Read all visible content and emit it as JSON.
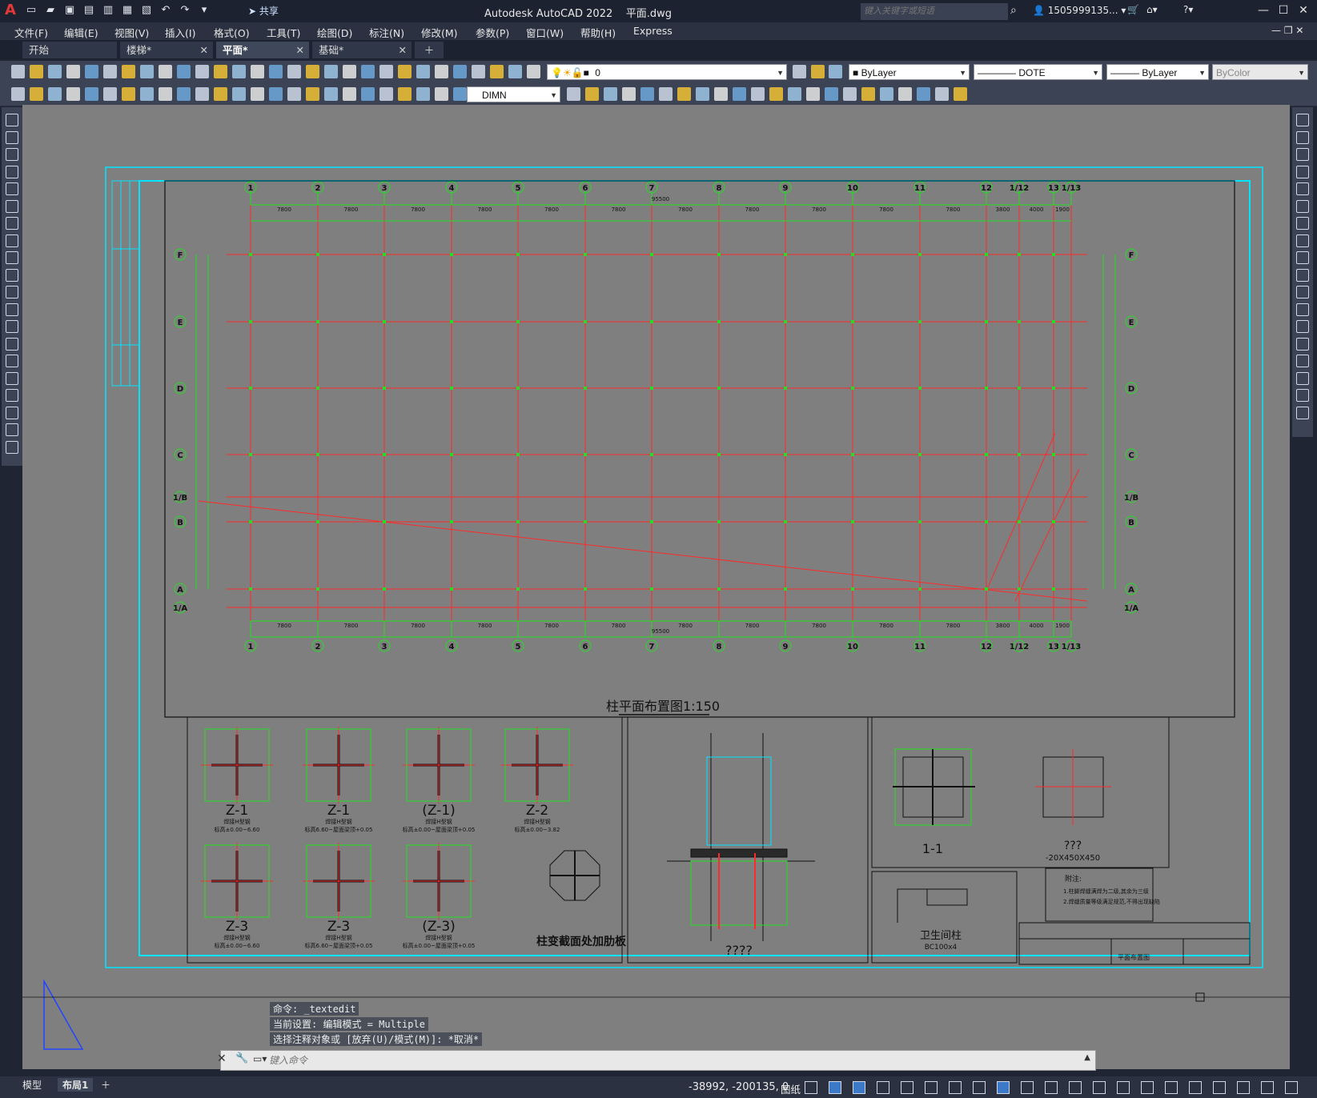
{
  "app": {
    "title": "Autodesk AutoCAD 2022",
    "document": "平面.dwg",
    "share_label": "共享",
    "search_placeholder": "键入关键字或短语",
    "user": "1505999135...",
    "logo": "A"
  },
  "menu": [
    "文件(F)",
    "编辑(E)",
    "视图(V)",
    "插入(I)",
    "格式(O)",
    "工具(T)",
    "绘图(D)",
    "标注(N)",
    "修改(M)",
    "参数(P)",
    "窗口(W)",
    "帮助(H)",
    "Express"
  ],
  "tabs": [
    {
      "label": "开始",
      "active": false,
      "closable": false
    },
    {
      "label": "楼梯*",
      "active": false,
      "closable": true
    },
    {
      "label": "平面*",
      "active": true,
      "closable": true
    },
    {
      "label": "基础*",
      "active": false,
      "closable": true
    }
  ],
  "toolbar": {
    "layer_value": "0",
    "color_value": "ByLayer",
    "linetype_value": "DOTE",
    "lineweight_value": "ByLayer",
    "plotstyle_value": "ByColor",
    "dimstyle_value": "DIMN"
  },
  "drawing": {
    "grid_cols": [
      "1",
      "2",
      "3",
      "4",
      "5",
      "6",
      "7",
      "8",
      "9",
      "10",
      "11",
      "12",
      "1/12",
      "13",
      "1/13"
    ],
    "grid_rows": [
      "F",
      "E",
      "D",
      "C",
      "1/B",
      "B",
      "A",
      "1/A"
    ],
    "span_dims_top": [
      "7800",
      "7800",
      "7800",
      "7800",
      "7800",
      "7800",
      "7800",
      "7800",
      "7800",
      "7800",
      "7800",
      "3800",
      "4000",
      "1900"
    ],
    "total_dim": "95500",
    "plan_title": "柱平面布置图1:150",
    "sections": [
      {
        "name": "Z-1",
        "desc": "焊接H型钢",
        "elev": "标高±0.00~6.60"
      },
      {
        "name": "Z-1",
        "desc": "焊接H型钢",
        "elev": "标高6.60~屋面梁顶+0.05"
      },
      {
        "name": "(Z-1)",
        "desc": "焊接H型钢",
        "elev": "标高±0.00~屋面梁顶+0.05"
      },
      {
        "name": "Z-2",
        "desc": "焊接H型钢",
        "elev": "标高±0.00~3.82"
      },
      {
        "name": "Z-3",
        "desc": "焊接H型钢",
        "elev": "标高±0.00~6.60"
      },
      {
        "name": "Z-3",
        "desc": "焊接H型钢",
        "elev": "标高6.60~屋面梁顶+0.05"
      },
      {
        "name": "(Z-3)",
        "desc": "焊接H型钢",
        "elev": "标高±0.00~屋面梁顶+0.05"
      }
    ],
    "rib_title": "柱变截面处加肋板",
    "detail_title": "????",
    "base_1_1": "1-1",
    "base_q": "???",
    "base_plate": "-20X450X450",
    "toilet_col": "卫生间柱",
    "toilet_size": "BC100x4",
    "notes_title": "附注:",
    "notes": [
      "1.柱脚焊缝满焊为二级,其余为三级",
      "2.焊缝质量等级满足规范,不得出现缺陷"
    ],
    "frame_title": "平面布置图"
  },
  "command": {
    "history": [
      "命令: _textedit",
      "当前设置: 编辑模式 = Multiple",
      "选择注释对象或 [放弃(U)/模式(M)]: *取消*"
    ],
    "placeholder": "键入命令"
  },
  "status": {
    "model_tab": "模型",
    "layout_tab": "布局1",
    "coords": "-38992, -200135, 0",
    "paper": "图纸"
  },
  "colors": {
    "grid_red": "#ff2a2a",
    "grid_green": "#22e022",
    "frame_cyan": "#00e5ff",
    "paper_gray": "#808080"
  }
}
